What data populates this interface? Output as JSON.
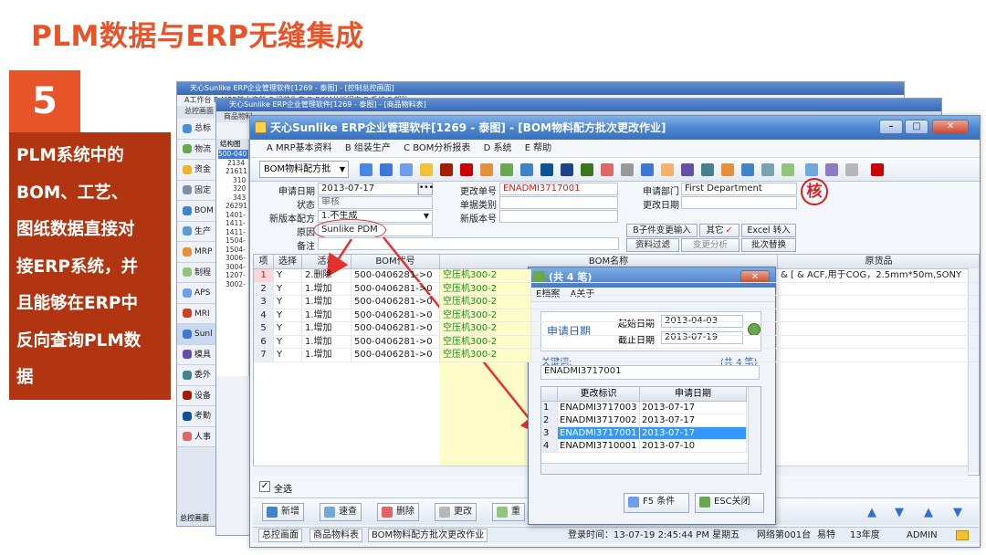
{
  "slide": {
    "title": "PLM数据与ERP无缝集成",
    "number": "5",
    "desc_lines": [
      "PLM系统中的",
      "BOM、工艺、",
      "图纸数据直接对",
      "接ERP系统，并",
      "且能够在ERP中",
      "反向查询PLM数",
      "据"
    ]
  },
  "back_windows": {
    "title1": "天心Sunlike ERP企业管理软件[1269 - 泰图] - [控制总控画面]",
    "title2": "天心Sunlike ERP企业管理软件[1269 - 泰图] - [商品物料表]",
    "menu1": "A工作台  B MRP基本资料  C 组装生产  D BOM分析报表  E 系统  F 帮助",
    "tabs": [
      "总控画面",
      "商品物料"
    ],
    "tree_header": "结构图",
    "tree_items": [
      "500-040",
      "2134",
      "21611",
      "310",
      "320",
      "343",
      "26291",
      "1401-",
      "1411-",
      "1411-",
      "1504-",
      "1504-",
      "3006-",
      "3004-",
      "1207-",
      "3002-"
    ],
    "side_items": [
      "总标",
      "物流",
      "资金",
      "固定",
      "BOM",
      "生产",
      "MRP",
      "制程",
      "APS",
      "MRI",
      "Sunl",
      "模具",
      "委外",
      "设备",
      "考勤",
      "人事"
    ],
    "bottom_tab": "总控画面"
  },
  "main": {
    "title": "天心Sunlike ERP企业管理软件[1269 - 泰图] - [BOM物料配方批次更改作业]",
    "menu": [
      "A MRP基本资料",
      "B 组装生产",
      "C BOM分析报表",
      "D 系统",
      "E 帮助"
    ],
    "toolbar_select": "BOM物料配方批",
    "form": {
      "apply_date_label": "申请日期",
      "apply_date": "2013-07-17",
      "status_label": "状态",
      "status": "审核",
      "new_ver_label": "新版本配方",
      "new_ver": "1.不生成",
      "reason_label": "原因",
      "reason": "Sunlike PDM",
      "note_label": "备注",
      "change_no_label": "更改单号",
      "change_no": "ENADMI3717001",
      "doc_type_label": "单据类别",
      "new_ver_no_label": "新版本号",
      "dept_label": "申请部门",
      "dept": "First Department",
      "change_date_label": "更改日期",
      "stamp": "核"
    },
    "buttons": {
      "child_input": "B子件变更输入",
      "other": "其它",
      "excel": "Excel 转入",
      "filter": "资料过滤",
      "change_analysis": "变更分析",
      "batch_replace": "批次替换"
    },
    "grid": {
      "headers": [
        "项",
        "选择",
        "活动",
        "BOM代号",
        "BOM名称",
        "原货品"
      ],
      "rows": [
        {
          "n": "1",
          "sel": "Y",
          "act": "2.删除",
          "code": "500-0406281->0",
          "name": "空压机300-2",
          "orig": "& [ & ACF,用于COG，2.5mm*50m,SONY"
        },
        {
          "n": "2",
          "sel": "Y",
          "act": "1.增加",
          "code": "500-0406281->0",
          "name": "空压机300-2",
          "orig": ""
        },
        {
          "n": "3",
          "sel": "Y",
          "act": "1.增加",
          "code": "500-0406281->0",
          "name": "空压机300-2",
          "orig": ""
        },
        {
          "n": "4",
          "sel": "Y",
          "act": "1.增加",
          "code": "500-0406281->0",
          "name": "空压机300-2",
          "orig": ""
        },
        {
          "n": "5",
          "sel": "Y",
          "act": "1.增加",
          "code": "500-0406281->0",
          "name": "空压机300-2",
          "orig": ""
        },
        {
          "n": "6",
          "sel": "Y",
          "act": "1.增加",
          "code": "500-0406281->0",
          "name": "空压机300-2",
          "orig": ""
        },
        {
          "n": "7",
          "sel": "Y",
          "act": "1.增加",
          "code": "500-0406281->0",
          "name": "空压机300-2",
          "orig": ""
        }
      ]
    },
    "select_all": "全选",
    "bottom_buttons": [
      "新增",
      "速查",
      "删除",
      "更改",
      "重"
    ],
    "status": {
      "tab1": "总控画面",
      "tab2": "商品物料表",
      "tab3": "BOM物料配方批次更改作业",
      "login": "登录时间：13-07-19 2:45:44 PM 星期五",
      "network": "网络第001台",
      "co": "易特",
      "year": "13年度",
      "user": "ADMIN"
    }
  },
  "dialog": {
    "title": "(共 4 笔)",
    "menu": [
      "E档案",
      "A关于"
    ],
    "apply_date_label": "申请日期",
    "start_label": "起始日期",
    "start": "2013-04-03",
    "end_label": "截止日期",
    "end": "2013-07-19",
    "keyword_label": "关键词:",
    "count": "(共 4 笔)",
    "keyword": "ENADMI3717001",
    "headers": [
      "更改标识",
      "申请日期"
    ],
    "rows": [
      {
        "n": "1",
        "id": "ENADMI3717003",
        "date": "2013-07-17"
      },
      {
        "n": "2",
        "id": "ENADMI3717002",
        "date": "2013-07-17"
      },
      {
        "n": "3",
        "id": "ENADMI3717001",
        "date": "2013-07-17"
      },
      {
        "n": "4",
        "id": "ENADMI3710001",
        "date": "2013-07-10"
      }
    ],
    "f5": "F5 条件",
    "esc": "ESC关闭"
  }
}
